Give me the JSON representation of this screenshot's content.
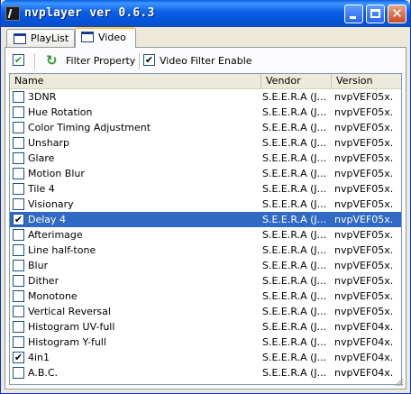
{
  "window": {
    "title": "nvplayer ver 0.6.3"
  },
  "tabs": [
    {
      "label": "PlayList"
    },
    {
      "label": "Video"
    }
  ],
  "toolbar": {
    "filter_property": "Filter Property",
    "video_filter_enable": "Video Filter Enable",
    "video_filter_enable_checked": true,
    "select_all_checked": true
  },
  "columns": {
    "name": "Name",
    "vendor": "Vendor",
    "version": "Version"
  },
  "filters": [
    {
      "name": "3DNR",
      "vendor": "S.E.E.R.A (J...",
      "version": "nvpVEF05x...",
      "checked": false
    },
    {
      "name": "Hue Rotation",
      "vendor": "S.E.E.R.A (J...",
      "version": "nvpVEF05x...",
      "checked": false
    },
    {
      "name": "Color Timing Adjustment",
      "vendor": "S.E.E.R.A (J...",
      "version": "nvpVEF05x...",
      "checked": false
    },
    {
      "name": "Unsharp",
      "vendor": "S.E.E.R.A (J...",
      "version": "nvpVEF05x...",
      "checked": false
    },
    {
      "name": "Glare",
      "vendor": "S.E.E.R.A (J...",
      "version": "nvpVEF05x...",
      "checked": false
    },
    {
      "name": "Motion Blur",
      "vendor": "S.E.E.R.A (J...",
      "version": "nvpVEF05x...",
      "checked": false
    },
    {
      "name": "Tile 4",
      "vendor": "S.E.E.R.A (J...",
      "version": "nvpVEF05x...",
      "checked": false
    },
    {
      "name": "Visionary",
      "vendor": "S.E.E.R.A (J...",
      "version": "nvpVEF05x...",
      "checked": false
    },
    {
      "name": "Delay 4",
      "vendor": "S.E.E.R.A (J...",
      "version": "nvpVEF05x...",
      "checked": true,
      "selected": true
    },
    {
      "name": "Afterimage",
      "vendor": "S.E.E.R.A (J...",
      "version": "nvpVEF05x...",
      "checked": false
    },
    {
      "name": "Line half-tone",
      "vendor": "S.E.E.R.A (J...",
      "version": "nvpVEF05x...",
      "checked": false
    },
    {
      "name": "Blur",
      "vendor": "S.E.E.R.A (J...",
      "version": "nvpVEF05x...",
      "checked": false
    },
    {
      "name": "Dither",
      "vendor": "S.E.E.R.A (J...",
      "version": "nvpVEF05x...",
      "checked": false
    },
    {
      "name": "Monotone",
      "vendor": "S.E.E.R.A (J...",
      "version": "nvpVEF05x...",
      "checked": false
    },
    {
      "name": "Vertical Reversal",
      "vendor": "S.E.E.R.A (J...",
      "version": "nvpVEF05x...",
      "checked": false
    },
    {
      "name": "Histogram UV-full",
      "vendor": "S.E.E.R.A (J...",
      "version": "nvpVEF04x...",
      "checked": false
    },
    {
      "name": "Histogram Y-full",
      "vendor": "S.E.E.R.A (J...",
      "version": "nvpVEF04x...",
      "checked": false
    },
    {
      "name": "4in1",
      "vendor": "S.E.E.R.A (J...",
      "version": "nvpVEF04x...",
      "checked": true
    },
    {
      "name": "A.B.C.",
      "vendor": "S.E.E.R.A (J...",
      "version": "nvpVEF04x...",
      "checked": false
    }
  ],
  "colors": {
    "titlebar": "#0a5ee8",
    "selection": "#316ac5",
    "face": "#ece9d8"
  }
}
